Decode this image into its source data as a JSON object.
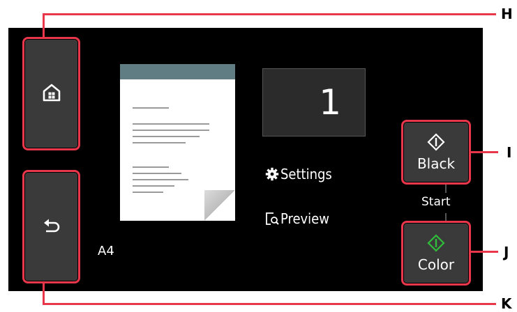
{
  "callouts": {
    "h": "H",
    "i": "I",
    "j": "J",
    "k": "K"
  },
  "count": {
    "value": "1"
  },
  "menu": {
    "settings_label": "Settings",
    "preview_label": "Preview"
  },
  "paper": {
    "size": "A4"
  },
  "start": {
    "label": "Start",
    "black_label": "Black",
    "color_label": "Color"
  },
  "icons": {
    "home": "home-icon",
    "back": "back-arrow-icon",
    "settings": "gear-icon",
    "preview": "preview-icon",
    "start": "start-diamond-icon"
  },
  "colors": {
    "callout_outline": "#e8364a",
    "start_black": "#ffffff",
    "start_color": "#2fbf3a"
  }
}
